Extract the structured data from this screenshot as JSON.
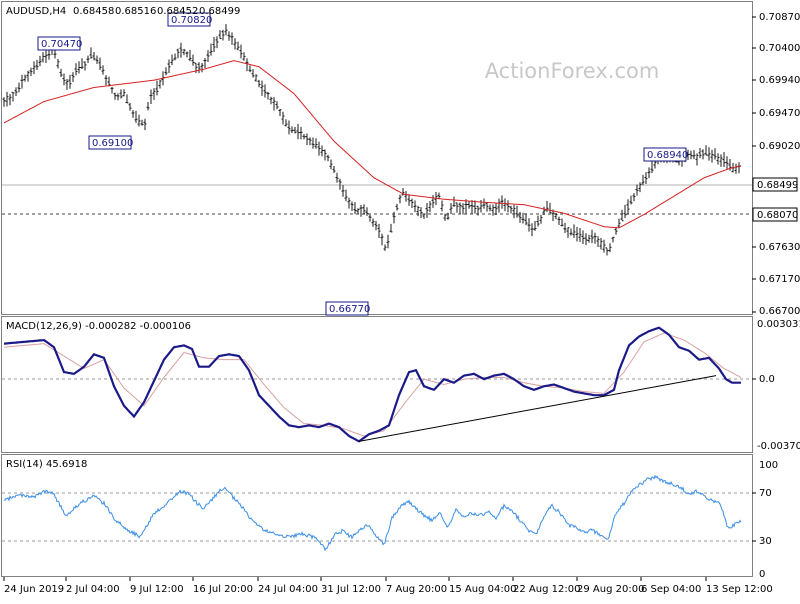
{
  "chart_data": [
    {
      "type": "ohlc",
      "title": "AUDUSD,H4",
      "ohlc_readout": [
        "0.68458",
        "0.68516",
        "0.68452",
        "0.68499"
      ],
      "watermark": "ActionForex.com",
      "ylim": [
        0.6607,
        0.7118
      ],
      "y_ticks": [
        "0.70870",
        "0.70400",
        "0.69940",
        "0.69470",
        "0.69020",
        "0.68499",
        "0.68070",
        "0.67630",
        "0.67170",
        "0.66700"
      ],
      "x_ticks": [
        "24 Jun 2019",
        "2 Jul 04:00",
        "9 Jul 12:00",
        "16 Jul 20:00",
        "24 Jul 04:00",
        "31 Jul 12:00",
        "7 Aug 20:00",
        "15 Aug 04:00",
        "22 Aug 12:00",
        "29 Aug 20:00",
        "6 Sep 04:00",
        "13 Sep 12:00"
      ],
      "current_price": "0.68499",
      "support_level": "0.68070",
      "annotations": [
        {
          "label": "0.70470",
          "value": 0.7047
        },
        {
          "label": "0.69100",
          "value": 0.691
        },
        {
          "label": "0.70820",
          "value": 0.7082
        },
        {
          "label": "0.66770",
          "value": 0.6677
        },
        {
          "label": "0.68940",
          "value": 0.6894
        }
      ],
      "price_path": [
        [
          0,
          0.6955
        ],
        [
          10,
          0.6968
        ],
        [
          20,
          0.6992
        ],
        [
          30,
          0.701
        ],
        [
          40,
          0.7028
        ],
        [
          50,
          0.704
        ],
        [
          57,
          0.7
        ],
        [
          65,
          0.6983
        ],
        [
          72,
          0.7005
        ],
        [
          80,
          0.7015
        ],
        [
          88,
          0.7032
        ],
        [
          95,
          0.7018
        ],
        [
          103,
          0.699
        ],
        [
          112,
          0.6962
        ],
        [
          120,
          0.6968
        ],
        [
          127,
          0.6942
        ],
        [
          134,
          0.6922
        ],
        [
          141,
          0.6918
        ],
        [
          146,
          0.6962
        ],
        [
          152,
          0.6972
        ],
        [
          160,
          0.6998
        ],
        [
          168,
          0.7022
        ],
        [
          176,
          0.704
        ],
        [
          185,
          0.703
        ],
        [
          193,
          0.7012
        ],
        [
          200,
          0.7015
        ],
        [
          208,
          0.7042
        ],
        [
          215,
          0.706
        ],
        [
          222,
          0.7072
        ],
        [
          228,
          0.7058
        ],
        [
          236,
          0.704
        ],
        [
          243,
          0.7018
        ],
        [
          250,
          0.6998
        ],
        [
          258,
          0.6978
        ],
        [
          266,
          0.696
        ],
        [
          274,
          0.6945
        ],
        [
          282,
          0.6918
        ],
        [
          290,
          0.6908
        ],
        [
          298,
          0.6902
        ],
        [
          306,
          0.689
        ],
        [
          314,
          0.688
        ],
        [
          322,
          0.687
        ],
        [
          330,
          0.6842
        ],
        [
          338,
          0.6815
        ],
        [
          345,
          0.679
        ],
        [
          352,
          0.6775
        ],
        [
          360,
          0.678
        ],
        [
          368,
          0.6762
        ],
        [
          375,
          0.6745
        ],
        [
          382,
          0.6712
        ],
        [
          390,
          0.6765
        ],
        [
          398,
          0.6808
        ],
        [
          405,
          0.6795
        ],
        [
          412,
          0.6782
        ],
        [
          420,
          0.6768
        ],
        [
          428,
          0.679
        ],
        [
          435,
          0.68
        ],
        [
          442,
          0.676
        ],
        [
          450,
          0.6788
        ],
        [
          458,
          0.6782
        ],
        [
          466,
          0.6785
        ],
        [
          474,
          0.678
        ],
        [
          482,
          0.6788
        ],
        [
          490,
          0.6778
        ],
        [
          498,
          0.679
        ],
        [
          506,
          0.6782
        ],
        [
          514,
          0.677
        ],
        [
          522,
          0.6758
        ],
        [
          530,
          0.6745
        ],
        [
          537,
          0.6762
        ],
        [
          542,
          0.6782
        ],
        [
          550,
          0.677
        ],
        [
          558,
          0.6755
        ],
        [
          566,
          0.6742
        ],
        [
          574,
          0.6738
        ],
        [
          582,
          0.6728
        ],
        [
          590,
          0.6735
        ],
        [
          598,
          0.672
        ],
        [
          605,
          0.6708
        ],
        [
          612,
          0.6745
        ],
        [
          620,
          0.677
        ],
        [
          628,
          0.6795
        ],
        [
          636,
          0.6815
        ],
        [
          644,
          0.6838
        ],
        [
          652,
          0.6855
        ],
        [
          660,
          0.6865
        ],
        [
          668,
          0.6862
        ],
        [
          676,
          0.6858
        ],
        [
          684,
          0.687
        ],
        [
          692,
          0.6862
        ],
        [
          700,
          0.6872
        ],
        [
          708,
          0.6868
        ],
        [
          716,
          0.686
        ],
        [
          724,
          0.6855
        ],
        [
          730,
          0.6842
        ],
        [
          737,
          0.685
        ]
      ],
      "moving_average": [
        [
          0,
          0.692
        ],
        [
          40,
          0.6955
        ],
        [
          90,
          0.6978
        ],
        [
          150,
          0.699
        ],
        [
          200,
          0.7008
        ],
        [
          230,
          0.7022
        ],
        [
          255,
          0.7012
        ],
        [
          290,
          0.6968
        ],
        [
          330,
          0.689
        ],
        [
          370,
          0.683
        ],
        [
          400,
          0.6803
        ],
        [
          440,
          0.6795
        ],
        [
          480,
          0.679
        ],
        [
          520,
          0.6786
        ],
        [
          560,
          0.6772
        ],
        [
          600,
          0.675
        ],
        [
          615,
          0.6748
        ],
        [
          640,
          0.677
        ],
        [
          670,
          0.68
        ],
        [
          700,
          0.683
        ],
        [
          725,
          0.6845
        ],
        [
          737,
          0.685
        ]
      ]
    },
    {
      "type": "line",
      "title": "MACD(12,26,9) -0.000282 -0.000106",
      "ylim": [
        -0.0042,
        0.0034
      ],
      "y_ticks": [
        "0.003031",
        "0.0",
        "-0.003706"
      ],
      "macd_line": [
        [
          0,
          0.0019
        ],
        [
          20,
          0.002
        ],
        [
          40,
          0.0021
        ],
        [
          50,
          0.0017
        ],
        [
          60,
          0.0003
        ],
        [
          70,
          0.0002
        ],
        [
          80,
          0.0006
        ],
        [
          90,
          0.0013
        ],
        [
          100,
          0.0011
        ],
        [
          110,
          -0.0005
        ],
        [
          120,
          -0.0016
        ],
        [
          130,
          -0.0022
        ],
        [
          140,
          -0.0014
        ],
        [
          150,
          -0.0002
        ],
        [
          160,
          0.001
        ],
        [
          170,
          0.0017
        ],
        [
          180,
          0.0018
        ],
        [
          188,
          0.0016
        ],
        [
          195,
          0.0006
        ],
        [
          205,
          0.0006
        ],
        [
          215,
          0.0012
        ],
        [
          225,
          0.0013
        ],
        [
          235,
          0.0012
        ],
        [
          245,
          0.0004
        ],
        [
          255,
          -0.001
        ],
        [
          265,
          -0.0016
        ],
        [
          275,
          -0.0022
        ],
        [
          285,
          -0.0027
        ],
        [
          295,
          -0.0028
        ],
        [
          305,
          -0.0027
        ],
        [
          315,
          -0.0028
        ],
        [
          325,
          -0.0026
        ],
        [
          335,
          -0.0028
        ],
        [
          345,
          -0.0033
        ],
        [
          355,
          -0.0036
        ],
        [
          365,
          -0.0032
        ],
        [
          375,
          -0.003
        ],
        [
          385,
          -0.0027
        ],
        [
          395,
          -0.001
        ],
        [
          405,
          0.0003
        ],
        [
          412,
          0.0004
        ],
        [
          420,
          -0.0005
        ],
        [
          430,
          -0.0007
        ],
        [
          440,
          -0.0001
        ],
        [
          450,
          -0.0003
        ],
        [
          460,
          0.0001
        ],
        [
          470,
          0.0002
        ],
        [
          480,
          -0.0001
        ],
        [
          490,
          0.0001
        ],
        [
          500,
          0.0002
        ],
        [
          510,
          -0.0001
        ],
        [
          520,
          -0.0005
        ],
        [
          530,
          -0.0007
        ],
        [
          540,
          -0.0005
        ],
        [
          550,
          -0.0004
        ],
        [
          560,
          -0.0006
        ],
        [
          570,
          -0.0008
        ],
        [
          580,
          -0.0009
        ],
        [
          590,
          -0.001
        ],
        [
          600,
          -0.001
        ],
        [
          610,
          -0.0007
        ],
        [
          615,
          0.0004
        ],
        [
          625,
          0.0018
        ],
        [
          635,
          0.0023
        ],
        [
          645,
          0.0026
        ],
        [
          655,
          0.0028
        ],
        [
          665,
          0.0024
        ],
        [
          675,
          0.0017
        ],
        [
          685,
          0.0015
        ],
        [
          695,
          0.001
        ],
        [
          705,
          0.0011
        ],
        [
          715,
          0.0005
        ],
        [
          722,
          -0.0001
        ],
        [
          728,
          -0.0003
        ],
        [
          737,
          -0.0003
        ]
      ],
      "signal_line": [
        [
          0,
          0.0017
        ],
        [
          40,
          0.0019
        ],
        [
          60,
          0.0012
        ],
        [
          80,
          0.0005
        ],
        [
          100,
          0.001
        ],
        [
          120,
          -0.0006
        ],
        [
          140,
          -0.0016
        ],
        [
          160,
          0.0
        ],
        [
          180,
          0.0014
        ],
        [
          200,
          0.0011
        ],
        [
          220,
          0.001
        ],
        [
          240,
          0.001
        ],
        [
          260,
          -0.0004
        ],
        [
          280,
          -0.0017
        ],
        [
          300,
          -0.0026
        ],
        [
          320,
          -0.0027
        ],
        [
          340,
          -0.0029
        ],
        [
          360,
          -0.0033
        ],
        [
          380,
          -0.003
        ],
        [
          400,
          -0.0015
        ],
        [
          420,
          -0.0001
        ],
        [
          440,
          -0.0004
        ],
        [
          460,
          -0.0001
        ],
        [
          480,
          0.0
        ],
        [
          500,
          0.0
        ],
        [
          520,
          -0.0003
        ],
        [
          540,
          -0.0005
        ],
        [
          560,
          -0.0006
        ],
        [
          580,
          -0.0008
        ],
        [
          600,
          -0.0009
        ],
        [
          620,
          0.0003
        ],
        [
          640,
          0.002
        ],
        [
          660,
          0.0025
        ],
        [
          680,
          0.0021
        ],
        [
          700,
          0.0014
        ],
        [
          720,
          0.0005
        ],
        [
          737,
          0.0
        ]
      ],
      "trendline": [
        [
          355,
          -0.0036
        ],
        [
          712,
          0.0001
        ]
      ]
    },
    {
      "type": "line",
      "title": "RSI(14) 45.6918",
      "ylim": [
        0,
        100
      ],
      "y_ticks": [
        "100",
        "70",
        "30",
        "0"
      ],
      "reference_levels": [
        70,
        30
      ],
      "rsi": [
        [
          0,
          62
        ],
        [
          10,
          66
        ],
        [
          20,
          67
        ],
        [
          30,
          65
        ],
        [
          40,
          70
        ],
        [
          50,
          68
        ],
        [
          56,
          58
        ],
        [
          62,
          50
        ],
        [
          70,
          56
        ],
        [
          80,
          62
        ],
        [
          90,
          66
        ],
        [
          100,
          60
        ],
        [
          110,
          48
        ],
        [
          120,
          40
        ],
        [
          128,
          36
        ],
        [
          135,
          33
        ],
        [
          142,
          40
        ],
        [
          150,
          52
        ],
        [
          160,
          58
        ],
        [
          168,
          64
        ],
        [
          176,
          70
        ],
        [
          185,
          68
        ],
        [
          193,
          60
        ],
        [
          200,
          56
        ],
        [
          208,
          63
        ],
        [
          215,
          70
        ],
        [
          222,
          72
        ],
        [
          230,
          64
        ],
        [
          238,
          57
        ],
        [
          246,
          48
        ],
        [
          254,
          42
        ],
        [
          262,
          37
        ],
        [
          270,
          35
        ],
        [
          280,
          33
        ],
        [
          290,
          33
        ],
        [
          298,
          35
        ],
        [
          306,
          33
        ],
        [
          314,
          30
        ],
        [
          322,
          22
        ],
        [
          330,
          34
        ],
        [
          338,
          37
        ],
        [
          348,
          32
        ],
        [
          356,
          38
        ],
        [
          364,
          42
        ],
        [
          372,
          34
        ],
        [
          380,
          26
        ],
        [
          388,
          48
        ],
        [
          396,
          57
        ],
        [
          404,
          62
        ],
        [
          412,
          56
        ],
        [
          420,
          50
        ],
        [
          428,
          46
        ],
        [
          436,
          52
        ],
        [
          444,
          40
        ],
        [
          452,
          55
        ],
        [
          460,
          48
        ],
        [
          468,
          52
        ],
        [
          476,
          50
        ],
        [
          484,
          53
        ],
        [
          492,
          48
        ],
        [
          500,
          58
        ],
        [
          508,
          54
        ],
        [
          516,
          46
        ],
        [
          524,
          38
        ],
        [
          532,
          34
        ],
        [
          540,
          50
        ],
        [
          548,
          58
        ],
        [
          556,
          52
        ],
        [
          564,
          42
        ],
        [
          572,
          40
        ],
        [
          580,
          36
        ],
        [
          588,
          38
        ],
        [
          596,
          34
        ],
        [
          604,
          30
        ],
        [
          612,
          52
        ],
        [
          620,
          60
        ],
        [
          628,
          70
        ],
        [
          636,
          76
        ],
        [
          644,
          80
        ],
        [
          652,
          82
        ],
        [
          660,
          78
        ],
        [
          668,
          76
        ],
        [
          676,
          74
        ],
        [
          684,
          68
        ],
        [
          692,
          70
        ],
        [
          700,
          66
        ],
        [
          708,
          62
        ],
        [
          716,
          60
        ],
        [
          724,
          40
        ],
        [
          730,
          42
        ],
        [
          737,
          46
        ]
      ]
    }
  ],
  "colors": {
    "price_bars": "#1a1a1a",
    "moving_average": "#d62020",
    "macd_line": "#1a1a88",
    "signal_line": "#d8a0a0",
    "trendline": "#000000",
    "rsi_line": "#3a8ee6",
    "grid": "#999999",
    "border": "#808080"
  }
}
